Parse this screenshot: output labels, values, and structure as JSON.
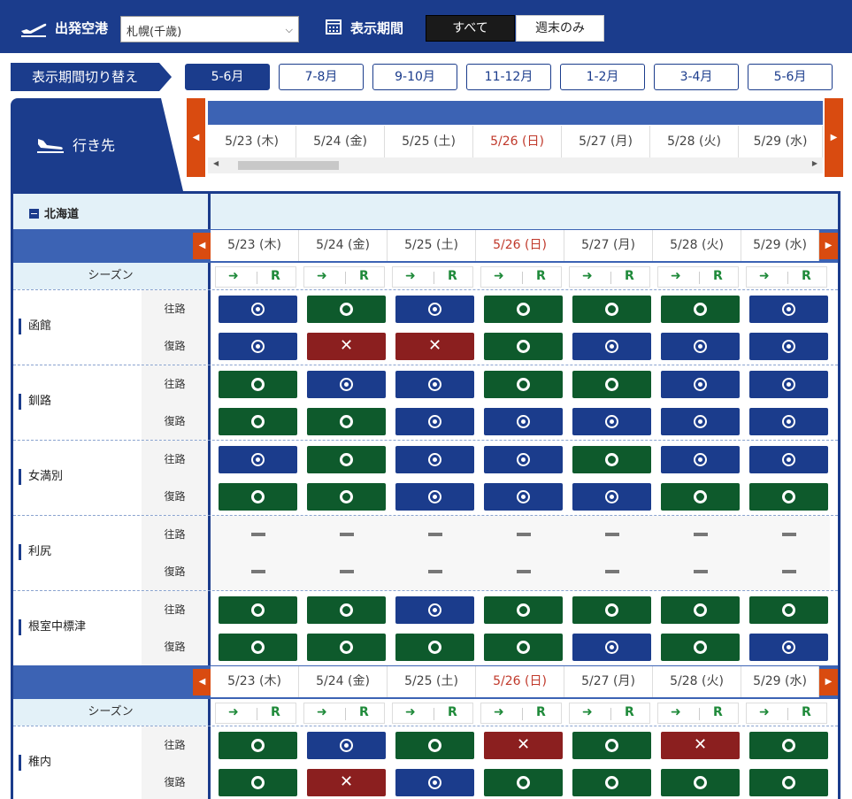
{
  "header": {
    "departure_label": "出発空港",
    "departure_value": "札幌(千歳)",
    "period_label": "表示期間",
    "all_label": "すべて",
    "weekend_label": "週末のみ"
  },
  "period_switch": {
    "label": "表示期間切り替え",
    "tabs": [
      "5-6月",
      "7-8月",
      "9-10月",
      "11-12月",
      "1-2月",
      "3-4月",
      "5-6月"
    ],
    "active_index": 0
  },
  "destination_tab": {
    "label": "行き先"
  },
  "dates": [
    "5/23 (木)",
    "5/24 (金)",
    "5/25 (土)",
    "5/26 (日)",
    "5/27 (月)",
    "5/28 (火)",
    "5/29 (水)"
  ],
  "sunday_index": 3,
  "region": {
    "name": "北海道"
  },
  "season_label": "シーズン",
  "season_marks": {
    "arrow": "➜",
    "r": "R"
  },
  "direction_labels": {
    "out": "往路",
    "ret": "復路"
  },
  "destinations": [
    {
      "name": "函館",
      "out": [
        "dot",
        "ring",
        "dot",
        "ring",
        "ring",
        "ring",
        "dot"
      ],
      "ret": [
        "dot",
        "x",
        "x",
        "ring",
        "dot",
        "dot",
        "dot"
      ]
    },
    {
      "name": "釧路",
      "out": [
        "ring",
        "dot",
        "dot",
        "ring",
        "ring",
        "dot",
        "dot"
      ],
      "ret": [
        "ring",
        "ring",
        "dot",
        "dot",
        "dot",
        "dot",
        "dot"
      ]
    },
    {
      "name": "女満別",
      "out": [
        "dot",
        "ring",
        "dot",
        "dot",
        "ring",
        "dot",
        "dot"
      ],
      "ret": [
        "ring",
        "ring",
        "dot",
        "dot",
        "dot",
        "ring",
        "ring"
      ]
    },
    {
      "name": "利尻",
      "out": [
        "dash",
        "dash",
        "dash",
        "dash",
        "dash",
        "dash",
        "dash"
      ],
      "ret": [
        "dash",
        "dash",
        "dash",
        "dash",
        "dash",
        "dash",
        "dash"
      ]
    },
    {
      "name": "根室中標津",
      "out": [
        "ring",
        "ring",
        "dot",
        "ring",
        "ring",
        "ring",
        "ring"
      ],
      "ret": [
        "ring",
        "ring",
        "ring",
        "ring",
        "dot",
        "ring",
        "dot"
      ]
    },
    {
      "name": "稚内",
      "out": [
        "ring",
        "dot",
        "ring",
        "x",
        "ring",
        "x",
        "ring"
      ],
      "ret": [
        "ring",
        "x",
        "dot",
        "ring",
        "ring",
        "ring",
        "ring"
      ]
    }
  ],
  "status_colors": {
    "ring": "#0e5a2c",
    "dot": "#1b3c8c",
    "x": "#8b1f1f"
  },
  "marks": {
    "x": "✕"
  },
  "icons": {
    "airplane": "airplane-takeoff-icon",
    "calendar": "calendar-icon",
    "landing": "airplane-landing-icon"
  }
}
